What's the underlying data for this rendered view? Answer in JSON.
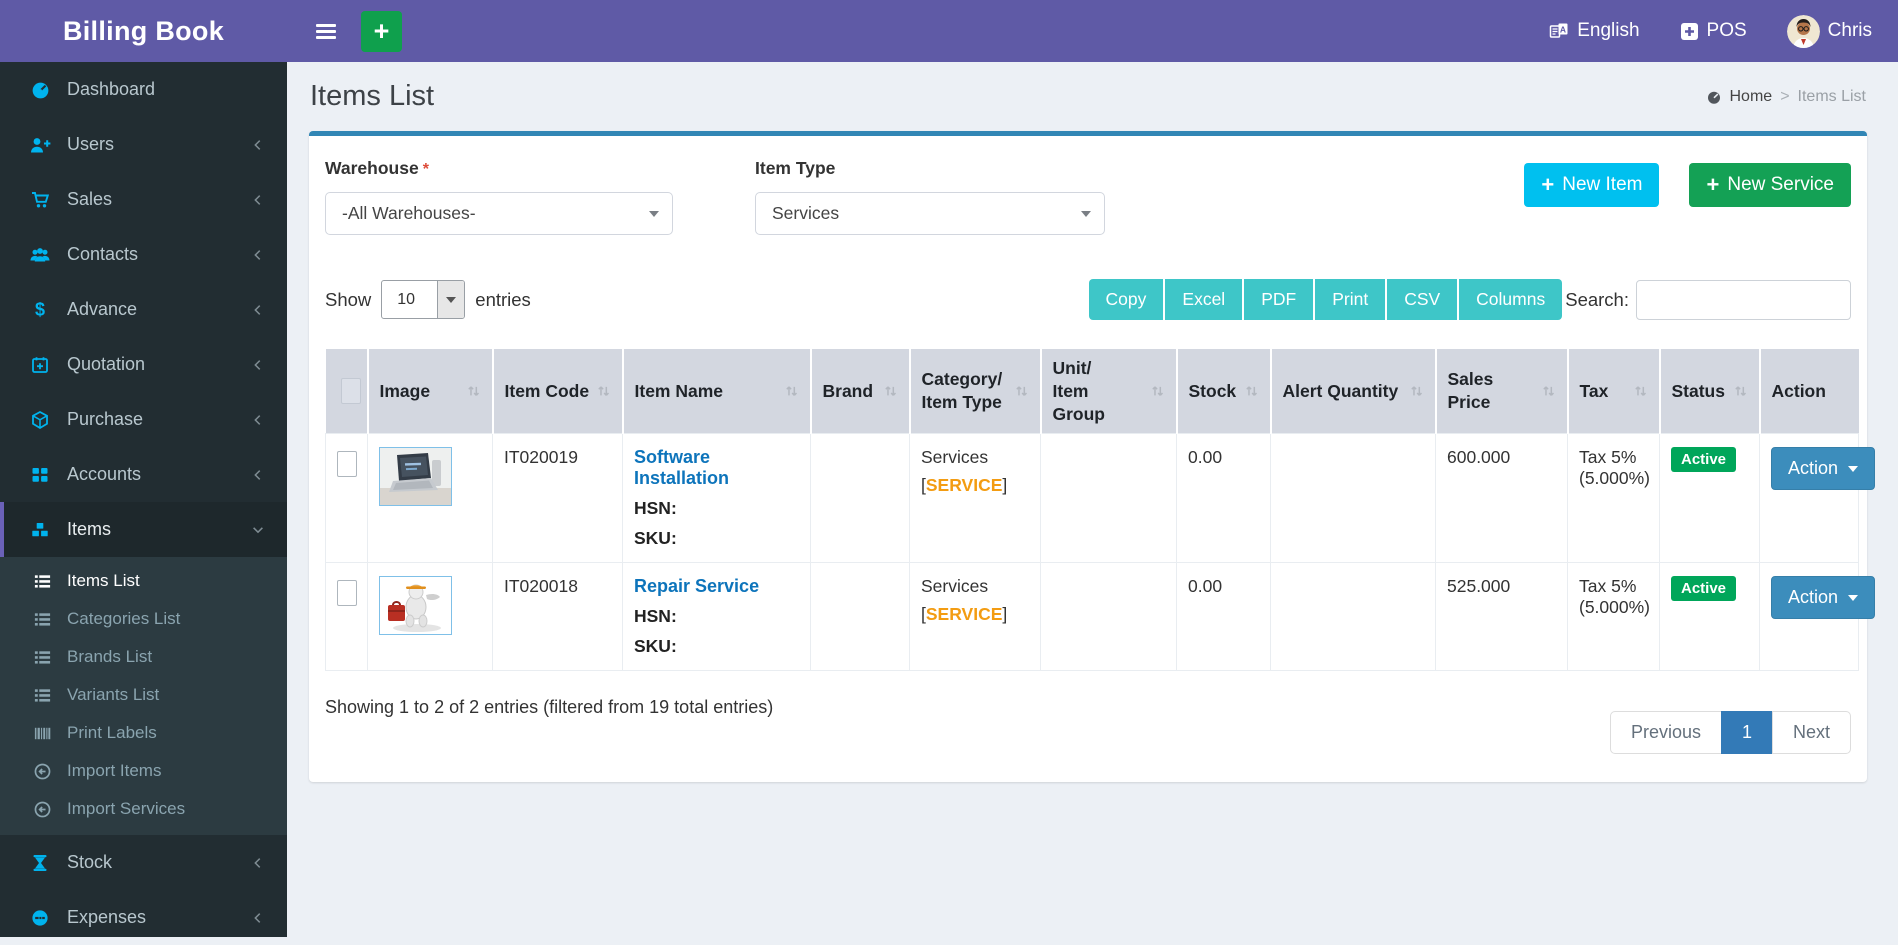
{
  "app": {
    "title": "Billing Book"
  },
  "navbar": {
    "language_label": "English",
    "pos_label": "POS",
    "user_name": "Chris",
    "quick_add_label": "+"
  },
  "sidebar": {
    "items": [
      {
        "label": "Dashboard"
      },
      {
        "label": "Users"
      },
      {
        "label": "Sales"
      },
      {
        "label": "Contacts"
      },
      {
        "label": "Advance"
      },
      {
        "label": "Quotation"
      },
      {
        "label": "Purchase"
      },
      {
        "label": "Accounts"
      },
      {
        "label": "Items"
      },
      {
        "label": "Stock"
      },
      {
        "label": "Expenses"
      }
    ],
    "items_submenu": [
      {
        "label": "Items List"
      },
      {
        "label": "Categories List"
      },
      {
        "label": "Brands List"
      },
      {
        "label": "Variants List"
      },
      {
        "label": "Print Labels"
      },
      {
        "label": "Import Items"
      },
      {
        "label": "Import Services"
      }
    ]
  },
  "page": {
    "title": "Items List",
    "breadcrumb": {
      "home": "Home",
      "separator": ">",
      "current": "Items List"
    }
  },
  "filters": {
    "warehouse_label": "Warehouse",
    "required_mark": "*",
    "warehouse_value": "-All Warehouses-",
    "item_type_label": "Item Type",
    "item_type_value": "Services"
  },
  "actions": {
    "plus": "+",
    "new_item_label": "New Item",
    "new_service_label": "New Service"
  },
  "controls": {
    "show_label": "Show",
    "page_length": "10",
    "entries_label": "entries",
    "export_buttons": [
      "Copy",
      "Excel",
      "PDF",
      "Print",
      "CSV",
      "Columns"
    ],
    "search_label": "Search:",
    "search_value": ""
  },
  "table": {
    "headers": [
      "",
      "Image",
      "Item Code",
      "Item Name",
      "Brand",
      {
        "line1": "Category/",
        "line2": "Item Type"
      },
      {
        "line1": "Unit/",
        "line2": "Item Group"
      },
      "Stock",
      "Alert Quantity",
      "Sales Price",
      "Tax",
      "Status",
      "Action"
    ],
    "rows": [
      {
        "image": "laptop-software-photo",
        "item_code": "IT020019",
        "item_name": "Software Installation",
        "hsn_label": "HSN:",
        "sku_label": "SKU:",
        "brand": "",
        "category": "Services",
        "category_tag_open": "[",
        "category_tag": "SERVICE",
        "category_tag_close": "]",
        "unit": "",
        "stock": "0.00",
        "alert_quantity": "",
        "sales_price": "600.000",
        "tax_line1": "Tax 5%",
        "tax_line2": "(5.000%)",
        "status": "Active",
        "action_label": "Action"
      },
      {
        "image": "repair-robot-figure",
        "item_code": "IT020018",
        "item_name": "Repair Service",
        "hsn_label": "HSN:",
        "sku_label": "SKU:",
        "brand": "",
        "category": "Services",
        "category_tag_open": "[",
        "category_tag": "SERVICE",
        "category_tag_close": "]",
        "unit": "",
        "stock": "0.00",
        "alert_quantity": "",
        "sales_price": "525.000",
        "tax_line1": "Tax 5%",
        "tax_line2": "(5.000%)",
        "status": "Active",
        "action_label": "Action"
      }
    ]
  },
  "footer": {
    "summary": "Showing 1 to 2 of 2 entries (filtered from 19 total entries)",
    "pagination": {
      "previous": "Previous",
      "page": "1",
      "next": "Next"
    }
  },
  "colors": {
    "navbar_purple": "#5f5aa6",
    "sidebar_dark": "#222d32",
    "sidebar_icon_cyan": "#00b3ee",
    "card_top_blue": "#3186b5",
    "info_cyan": "#00c0ef",
    "success_green": "#00a65a",
    "primary_blue": "#3c8dbc",
    "warning_orange": "#f39c12",
    "export_teal": "#3ec6c8",
    "link_blue": "#0d74bb",
    "danger_red": "#dd4b39"
  }
}
